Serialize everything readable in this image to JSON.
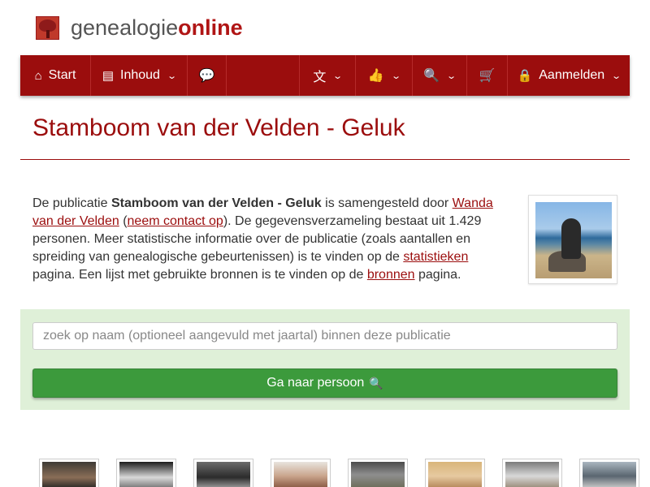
{
  "brand": {
    "part1": "genealogie",
    "part2": "online"
  },
  "nav": {
    "start": "Start",
    "inhoud": "Inhoud",
    "login": "Aanmelden",
    "icons": {
      "start": "home-icon",
      "inhoud": "book-icon",
      "chat": "comments-icon",
      "language": "language-icon",
      "like": "thumbs-up-icon",
      "search": "search-icon",
      "cart": "shopping-cart-icon",
      "lock": "lock-icon"
    }
  },
  "page": {
    "title": "Stamboom van der Velden - Geluk"
  },
  "intro": {
    "t1": "De publicatie ",
    "pub_name": "Stamboom van der Velden - Geluk",
    "t2": " is samengesteld door ",
    "author": "Wanda van der Velden",
    "t3": " (",
    "contact": "neem contact op",
    "t4": "). De gegevensverzameling bestaat uit 1.429 personen. Meer statistische informatie over de publicatie (zoals aantallen en spreiding van genealogische gebeurtenissen) is te vinden op de ",
    "stats": "statistieken",
    "t5": " pagina. Een lijst met gebruikte bronnen is te vinden op de ",
    "sources": "bronnen",
    "t6": " pagina."
  },
  "search": {
    "placeholder": "zoek op naam (optioneel aangevuld met jaartal) binnen deze publicatie",
    "button": "Ga naar persoon"
  },
  "colors": {
    "brand": "#9b0d0d",
    "panel": "#dff0d8",
    "button": "#3c9a3c"
  }
}
